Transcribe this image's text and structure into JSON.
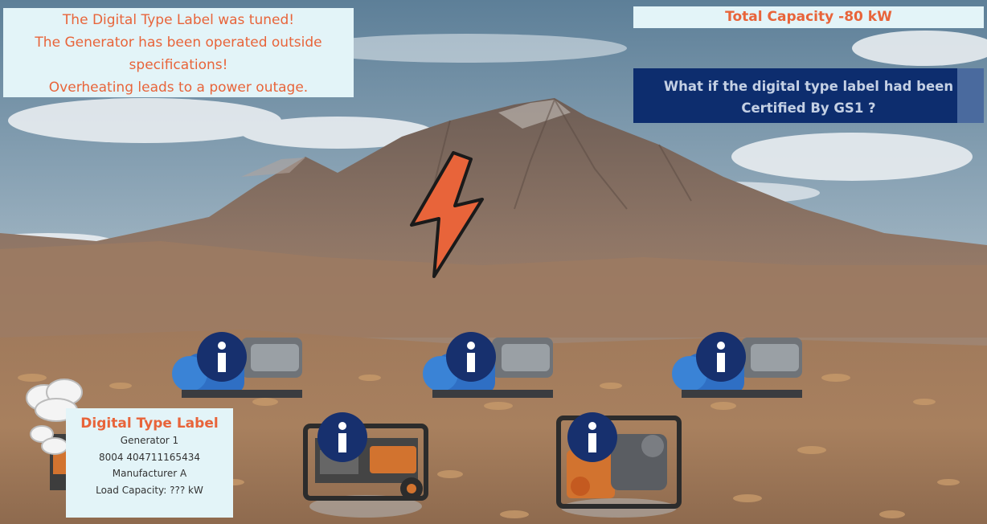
{
  "message": {
    "lines": [
      "The Digital Type Label was tuned!",
      "The Generator has been operated outside",
      "specifications!",
      "Overheating leads to a power outage."
    ]
  },
  "capacity": {
    "text": "Total Capacity -80 kW"
  },
  "gs1_prompt": {
    "lines": [
      "What if the digital type label had been",
      "Certified By GS1 ?"
    ]
  },
  "digital_type_label": {
    "title": "Digital Type Label",
    "name": "Generator 1",
    "code": "8004 404711165434",
    "manufacturer": "Manufacturer A",
    "load": "Load Capacity: ??? kW"
  },
  "colors": {
    "accent": "#e8643a",
    "panel": "#e3f4f8",
    "navy": "#0d2d6e",
    "info": "#17306e"
  },
  "icons": [
    "lightning-bolt-icon",
    "info-icon",
    "smoke-cloud-icon"
  ]
}
